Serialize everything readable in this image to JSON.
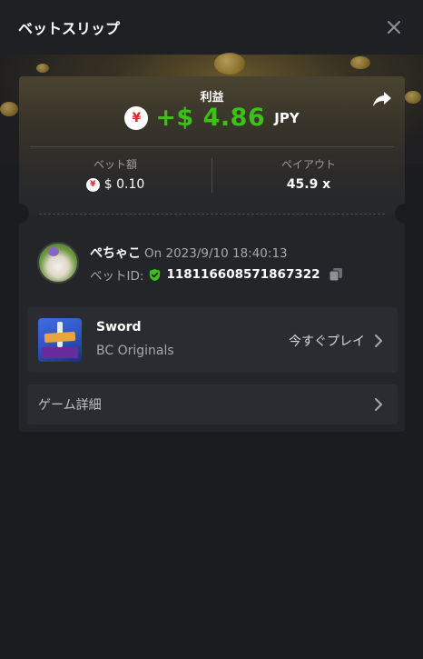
{
  "header": {
    "title": "ベットスリップ",
    "close_icon": "close-icon"
  },
  "summary": {
    "profit_label": "利益",
    "currency_icon": "yen-icon",
    "profit_amount": "+$ 4.86",
    "profit_currency": "JPY",
    "share_icon": "share-icon",
    "bet_amount_label": "ベット額",
    "bet_amount_value": "$ 0.10",
    "payout_label": "ペイアウト",
    "payout_value": "45.9 x"
  },
  "bet_info": {
    "username": "ぺちゃこ",
    "date": "On 2023/9/10 18:40:13",
    "bet_id_label": "ベットID:",
    "bet_id_value": "118116608571867322",
    "verified_icon": "shield-check-icon",
    "copy_icon": "copy-icon"
  },
  "game": {
    "name": "Sword",
    "provider": "BC Originals",
    "play_label": "今すぐプレイ"
  },
  "details": {
    "label": "ゲーム詳細"
  },
  "colors": {
    "profit_green": "#3bc117",
    "background": "#1b1c1f",
    "panel": "#232529",
    "card": "#2a2c31"
  }
}
